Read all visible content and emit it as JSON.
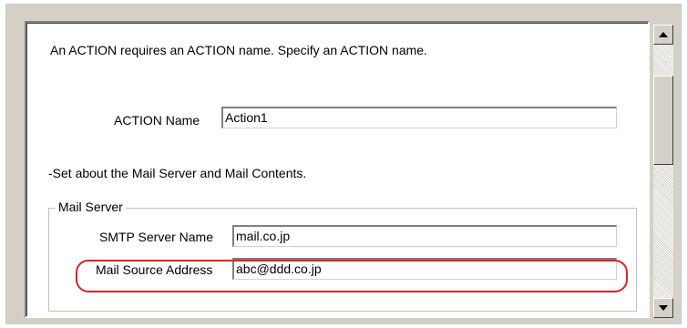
{
  "intro_text": "An ACTION requires an ACTION name. Specify an ACTION name.",
  "action_name": {
    "label": "ACTION Name",
    "value": "Action1"
  },
  "mail_section_text": "-Set about the Mail Server and Mail Contents.",
  "mail_server_group": {
    "title": "Mail Server",
    "smtp_label": "SMTP Server Name",
    "smtp_value": "mail.co.jp",
    "source_label": "Mail Source Address",
    "source_value": "abc@ddd.co.jp"
  },
  "colors": {
    "highlight": "#e0202a",
    "window_bg": "#d4d0c8"
  },
  "icons": [
    "scroll-up-arrow-icon",
    "scroll-down-arrow-icon"
  ]
}
